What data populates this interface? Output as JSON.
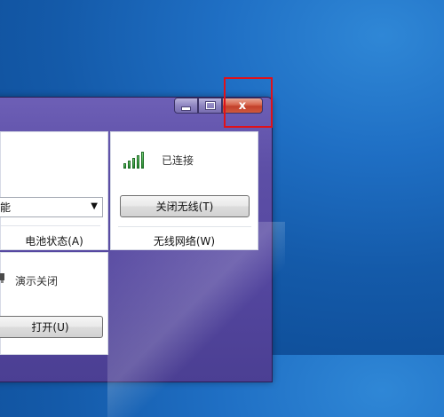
{
  "window": {
    "caption": {
      "minimize_label": "minimize",
      "maximize_label": "maximize",
      "close_glyph": "x"
    }
  },
  "wireless": {
    "status": "已连接",
    "toggle_button": "关闭无线(T)",
    "title": "无线网络(W)",
    "signal_bars": 5
  },
  "battery": {
    "dropdown_value": "能",
    "title": "电池状态(A)"
  },
  "presentation": {
    "status": "演示关闭",
    "button": "打开(U)"
  },
  "colors": {
    "highlight": "#e0111a",
    "signal": "#238b2d",
    "close_button": "#c2412b"
  }
}
